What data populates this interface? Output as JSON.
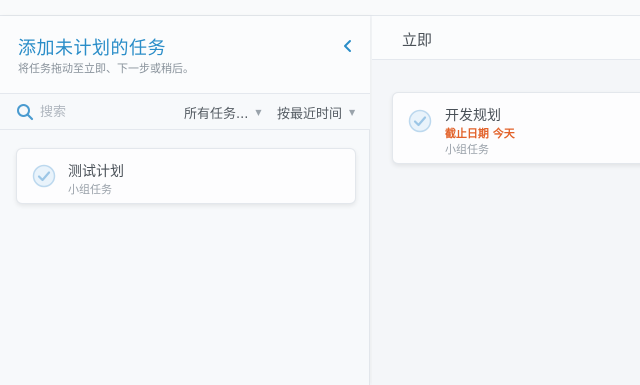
{
  "left_panel": {
    "title": "添加未计划的任务",
    "subtitle": "将任务拖动至立即、下一步或稍后。",
    "search": {
      "placeholder": "搜索"
    },
    "filters": {
      "tasks_label": "所有任务...",
      "sort_label": "按最近时间"
    },
    "tasks": [
      {
        "title": "测试计划",
        "group": "小组任务"
      }
    ]
  },
  "right_panel": {
    "title": "立即",
    "tasks": [
      {
        "title": "开发规划",
        "due": "截止日期 今天",
        "group": "小组任务"
      }
    ]
  },
  "colors": {
    "accent": "#2a8dc8",
    "due": "#e2622a",
    "check": "#bcd8ee"
  },
  "icons": {
    "search": "search-icon",
    "collapse": "chevron-left-icon",
    "check": "check-circle-icon",
    "caret": "caret-down-icon"
  }
}
